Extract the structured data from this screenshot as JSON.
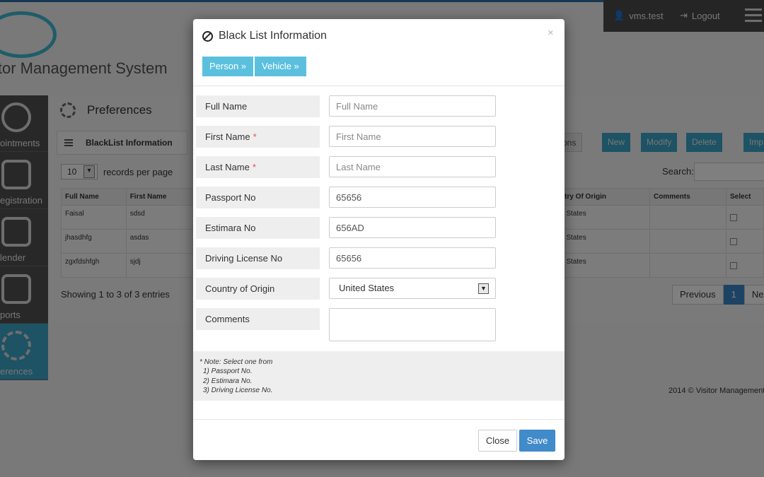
{
  "app": {
    "logo_text": "itor Management System",
    "footer": "2014 © Visitor Management"
  },
  "userbar": {
    "username": "vms.test",
    "logout": "Logout"
  },
  "nav": [
    {
      "label": "ointments",
      "icon": "clock-icon"
    },
    {
      "label": "egistration",
      "icon": "form-icon"
    },
    {
      "label": "lender",
      "icon": "calendar-icon"
    },
    {
      "label": "ports",
      "icon": "reports-icon"
    },
    {
      "label": "erences",
      "icon": "gear-icon",
      "active": true
    }
  ],
  "page": {
    "title": "Preferences",
    "subtitle": "BlackList Information",
    "length_value": "10",
    "length_label": "records per page",
    "search_label": "Search:",
    "showing": "Showing 1 to 3 of 3 entries",
    "toolbar": {
      "options": "ons",
      "new": "New",
      "modify": "Modify",
      "delete": "Delete",
      "import": "Imp"
    },
    "table_left": {
      "columns": [
        "Full Name",
        "First Name"
      ],
      "rows": [
        [
          "Faisal",
          "sdsd"
        ],
        [
          "jhasdhfg",
          "asdas"
        ],
        [
          "zgxfdshfgh",
          "sjdj"
        ]
      ]
    },
    "table_right": {
      "columns": [
        "ntry Of Origin",
        "Comments",
        "Select"
      ],
      "rows": [
        [
          "d States",
          ""
        ],
        [
          "d States",
          ""
        ],
        [
          "d States",
          ""
        ]
      ]
    },
    "pager": {
      "previous": "Previous",
      "current": "1",
      "next": "Nex"
    }
  },
  "modal": {
    "title": "Black List Information",
    "close_glyph": "×",
    "tabs": [
      "Person »",
      "Vehicle »"
    ],
    "fields": {
      "full_name": {
        "label": "Full Name",
        "placeholder": "Full Name",
        "value": ""
      },
      "first_name": {
        "label": "First Name",
        "placeholder": "First Name",
        "value": "",
        "required": "*"
      },
      "last_name": {
        "label": "Last Name",
        "placeholder": "Last Name",
        "value": "",
        "required": "*"
      },
      "passport": {
        "label": "Passport No",
        "placeholder": "",
        "value": "65656"
      },
      "estimara": {
        "label": "Estimara No",
        "placeholder": "",
        "value": "656AD"
      },
      "license": {
        "label": "Driving License No",
        "placeholder": "",
        "value": "65656"
      },
      "country": {
        "label": "Country of Origin",
        "value": "United States"
      },
      "comments": {
        "label": "Comments",
        "value": ""
      }
    },
    "note": {
      "line1": "* Note: Select one from",
      "line2": "1) Passport No.",
      "line3": "2) Estimara No.",
      "line4": "3) Driving License No."
    },
    "buttons": {
      "close": "Close",
      "save": "Save"
    }
  }
}
